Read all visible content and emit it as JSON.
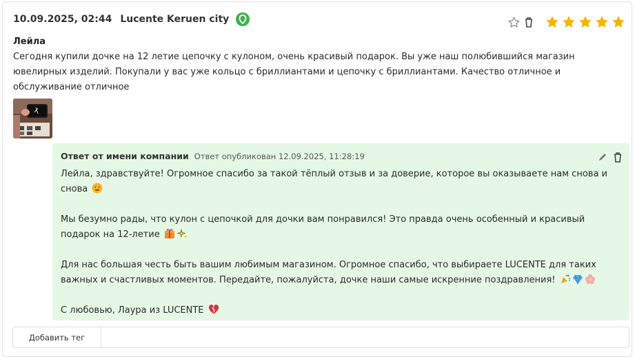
{
  "review": {
    "date": "10.09.2025, 02:44",
    "location": "Lucente Keruen city",
    "author": "Лейла",
    "text": "Сегодня купили дочке на 12 летие цепочку с кулоном, очень красивый подарок. Вы уже наш полюбившийся магазин ювелирных изделий. Покупали у вас уже кольцо с бриллиантами и цепочку с бриллиантами. Качество отличное и обслуживание отличное",
    "rating": 5,
    "rating_max": 5,
    "star_color": "#f5b400",
    "source_icon": "location-pin-icon"
  },
  "reply": {
    "title": "Ответ от имени компании",
    "meta": "Ответ опубликован 12.09.2025, 11:28:19",
    "paragraphs": [
      "Лейла, здравствуйте! Огромное спасибо за такой тёплый отзыв и за доверие, которое вы оказываете нам снова и снова",
      "Мы безумно рады, что кулон с цепочкой для дочки вам понравился! Это правда очень особенный и красивый подарок на 12-летие",
      "Для нас большая честь быть вашим любимым магазином. Огромное спасибо, что выбираете LUCENTE для таких важных и счастливых моментов. Передайте, пожалуйста, дочке наши самые искренние поздравления!",
      "С любовью, Лаура из LUCENTE"
    ],
    "background": "#e5f8e5"
  },
  "tags": {
    "add_label": "Добавить тег"
  }
}
